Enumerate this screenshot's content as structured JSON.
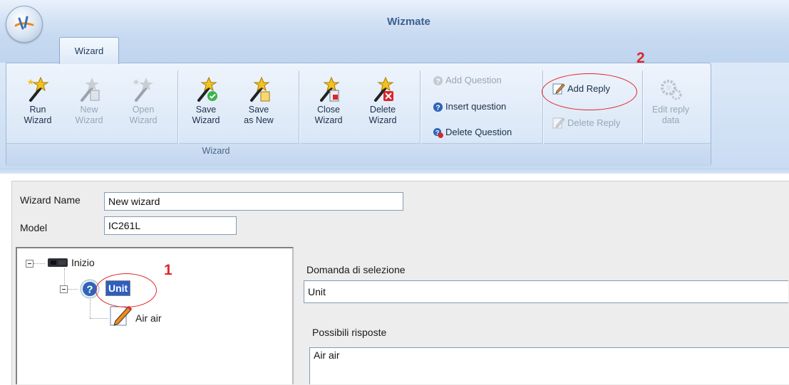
{
  "app": {
    "title": "Wizmate"
  },
  "tabs": [
    {
      "label": "Wizard",
      "active": true
    }
  ],
  "ribbon": {
    "group_label": "Wizard",
    "buttons": [
      {
        "label": "Run\nWizard",
        "enabled": true,
        "icon": "magic-wand-icon"
      },
      {
        "label": "New\nWizard",
        "enabled": false,
        "icon": "magic-wand-new-icon"
      },
      {
        "label": "Open\nWizard",
        "enabled": false,
        "icon": "magic-wand-open-icon"
      },
      {
        "label": "Save\nWizard",
        "enabled": true,
        "icon": "magic-wand-save-icon"
      },
      {
        "label": "Save\nas New",
        "enabled": true,
        "icon": "magic-wand-save-as-icon"
      },
      {
        "label": "Close\nWizard",
        "enabled": true,
        "icon": "magic-wand-close-icon"
      },
      {
        "label": "Delete\nWizard",
        "enabled": true,
        "icon": "magic-wand-delete-icon"
      }
    ],
    "question_actions": [
      {
        "label": "Add Question",
        "enabled": false,
        "icon": "question-add-icon"
      },
      {
        "label": "Insert question",
        "enabled": true,
        "icon": "question-icon"
      },
      {
        "label": "Delete Question",
        "enabled": true,
        "icon": "question-delete-icon"
      }
    ],
    "reply_actions": [
      {
        "label": "Add Reply",
        "enabled": true,
        "icon": "pencil-icon"
      },
      {
        "label": "Delete Reply",
        "enabled": false,
        "icon": "pencil-delete-icon"
      }
    ],
    "edit_reply": {
      "label": "Edit reply\ndata",
      "enabled": false,
      "icon": "gears-icon"
    }
  },
  "annotations": {
    "marker_1": "1",
    "marker_2": "2"
  },
  "form": {
    "wizard_name_label": "Wizard Name",
    "wizard_name_value": "New wizard",
    "model_label": "Model",
    "model_value": "IC261L"
  },
  "tree": {
    "root": {
      "label": "Inizio",
      "icon": "device-icon"
    },
    "question": {
      "label": "Unit",
      "icon": "question-icon",
      "selected": true
    },
    "reply": {
      "label": "Air air",
      "icon": "pencil-icon"
    }
  },
  "details": {
    "question_label": "Domanda di selezione",
    "question_value": "Unit",
    "replies_label": "Possibili risposte",
    "replies_value": "Air air"
  },
  "colors": {
    "accent": "#2f5ebf",
    "annotation": "#e0262a",
    "ribbon": "#dae7f7"
  }
}
